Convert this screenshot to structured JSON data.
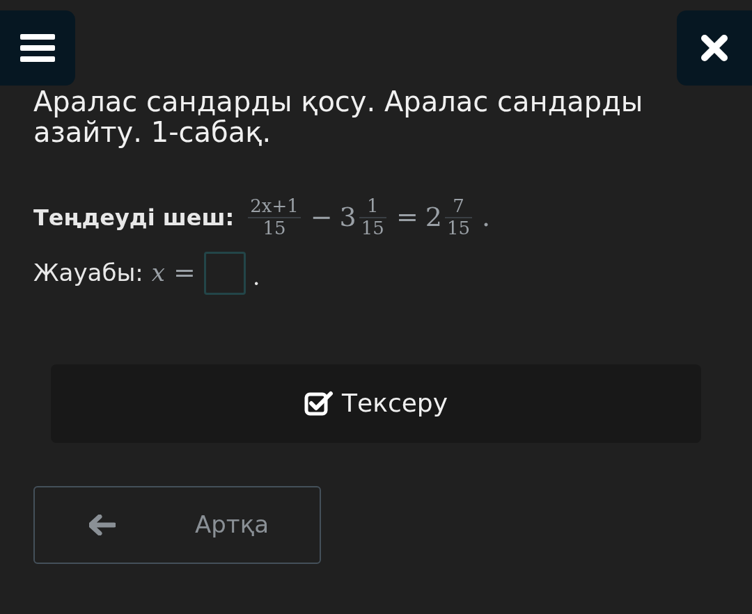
{
  "title": "Аралас сандарды қосу. Аралас сандарды азайту. 1-сабақ.",
  "task": {
    "label": "Теңдеуді шеш:",
    "equation": [
      {
        "kind": "frac",
        "num": "2x+1",
        "den": "15"
      },
      {
        "kind": "op",
        "text": "−"
      },
      {
        "kind": "mixed",
        "whole": "3",
        "num": "1",
        "den": "15"
      },
      {
        "kind": "op",
        "text": "="
      },
      {
        "kind": "mixed",
        "whole": "2",
        "num": "7",
        "den": "15"
      },
      {
        "kind": "op",
        "text": "."
      }
    ]
  },
  "answer": {
    "label": "Жауабы:",
    "variable": "x",
    "op": "=",
    "end": "."
  },
  "check_button": "Тексеру",
  "back_button": "Артқа"
}
